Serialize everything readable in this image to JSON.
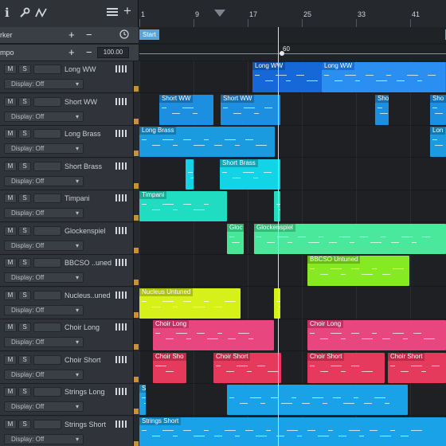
{
  "toolbar": {
    "info_icon": "i",
    "wrench_icon": "wrench",
    "automation_icon": "automation",
    "list_icon": "list",
    "add_icon": "+"
  },
  "ruler": {
    "bars": [
      "1",
      "9",
      "17",
      "25",
      "33",
      "41"
    ]
  },
  "marker_row": {
    "label": "rker",
    "start_marker": "Start"
  },
  "tempo_row": {
    "label": "mpo",
    "value": "100.00",
    "tempo_point": "60"
  },
  "tracks": [
    {
      "name": "Long WW",
      "mute": "M",
      "solo": "S",
      "display": "Display: Off"
    },
    {
      "name": "Short WW",
      "mute": "M",
      "solo": "S",
      "display": "Display: Off"
    },
    {
      "name": "Long Brass",
      "mute": "M",
      "solo": "S",
      "display": "Display: Off"
    },
    {
      "name": "Short Brass",
      "mute": "M",
      "solo": "S",
      "display": "Display: Off"
    },
    {
      "name": "Timpani",
      "mute": "M",
      "solo": "S",
      "display": "Display: Off"
    },
    {
      "name": "Glockenspiel",
      "mute": "M",
      "solo": "S",
      "display": "Display: Off"
    },
    {
      "name": "BBCSO ..uned",
      "mute": "M",
      "solo": "S",
      "display": "Display: Off"
    },
    {
      "name": "Nucleus..uned",
      "mute": "M",
      "solo": "S",
      "display": "Display: Off"
    },
    {
      "name": "Choir Long",
      "mute": "M",
      "solo": "S",
      "display": "Display: Off"
    },
    {
      "name": "Choir Short",
      "mute": "M",
      "solo": "S",
      "display": "Display: Off"
    },
    {
      "name": "Strings Long",
      "mute": "M",
      "solo": "S",
      "display": "Display: Off"
    },
    {
      "name": "Strings Short",
      "mute": "M",
      "solo": "S",
      "display": "Display: Off"
    }
  ],
  "clips": [
    {
      "track": 0,
      "label": "Long WW",
      "color": "#1668d8",
      "header": "#0f52b0"
    },
    {
      "track": 0,
      "label": "Long WW",
      "color": "#2a8ff0",
      "header": "#1a6fd0"
    },
    {
      "track": 0,
      "label": "",
      "color": "#1f7ee6",
      "header": "#1f7ee6"
    },
    {
      "track": 1,
      "label": "Short WW",
      "color": "#1c8fe0",
      "header": "#156fb3"
    },
    {
      "track": 1,
      "label": "Short WW",
      "color": "#1c8fe0",
      "header": "#156fb3"
    },
    {
      "track": 1,
      "label": "Sho",
      "color": "#1c8fe0",
      "header": "#156fb3"
    },
    {
      "track": 1,
      "label": "Sho",
      "color": "#1c8fe0",
      "header": "#156fb3"
    },
    {
      "track": 2,
      "label": "Long Brass",
      "color": "#1a9be0",
      "header": "#127ab3"
    },
    {
      "track": 2,
      "label": "Lon",
      "color": "#1a9be0",
      "header": "#127ab3"
    },
    {
      "track": 3,
      "label": "",
      "color": "#12d4e6",
      "header": "#12d4e6"
    },
    {
      "track": 3,
      "label": "Short Brass",
      "color": "#12d4e6",
      "header": "#0fa6b4"
    },
    {
      "track": 4,
      "label": "Timpani",
      "color": "#20dcc0",
      "header": "#17ad96"
    },
    {
      "track": 4,
      "label": "",
      "color": "#20dcc0",
      "header": "#20dcc0"
    },
    {
      "track": 5,
      "label": "Gloc",
      "color": "#46e898",
      "header": "#34b877"
    },
    {
      "track": 5,
      "label": "Glockenspiel",
      "color": "#4ae89a",
      "header": "#37b97a"
    },
    {
      "track": 6,
      "label": "BBCSO Untuned",
      "color": "#86ea22",
      "header": "#68ba16"
    },
    {
      "track": 7,
      "label": "Nucleus Untuned",
      "color": "#d6f01a",
      "header": "#acc212"
    },
    {
      "track": 7,
      "label": "",
      "color": "#d6f01a",
      "header": "#d6f01a"
    },
    {
      "track": 8,
      "label": "Choir Long",
      "color": "#e8467e",
      "header": "#c23262"
    },
    {
      "track": 8,
      "label": "Choir Long",
      "color": "#e8467e",
      "header": "#c23262"
    },
    {
      "track": 9,
      "label": "Choir Sho",
      "color": "#e63a5c",
      "header": "#c02a48"
    },
    {
      "track": 9,
      "label": "Choir Short",
      "color": "#e63a5c",
      "header": "#c02a48"
    },
    {
      "track": 9,
      "label": "Choir Short",
      "color": "#e63a5c",
      "header": "#c02a48"
    },
    {
      "track": 9,
      "label": "Choir Short",
      "color": "#e63a5c",
      "header": "#c02a48"
    },
    {
      "track": 10,
      "label": "Strings Long",
      "color": "#1aa2e8",
      "header": "#1282bb"
    },
    {
      "track": 10,
      "label": "",
      "color": "#1aa2e8",
      "header": "#1aa2e8"
    },
    {
      "track": 11,
      "label": "Strings Short",
      "color": "#1aa2e8",
      "header": "#1282bb"
    }
  ]
}
